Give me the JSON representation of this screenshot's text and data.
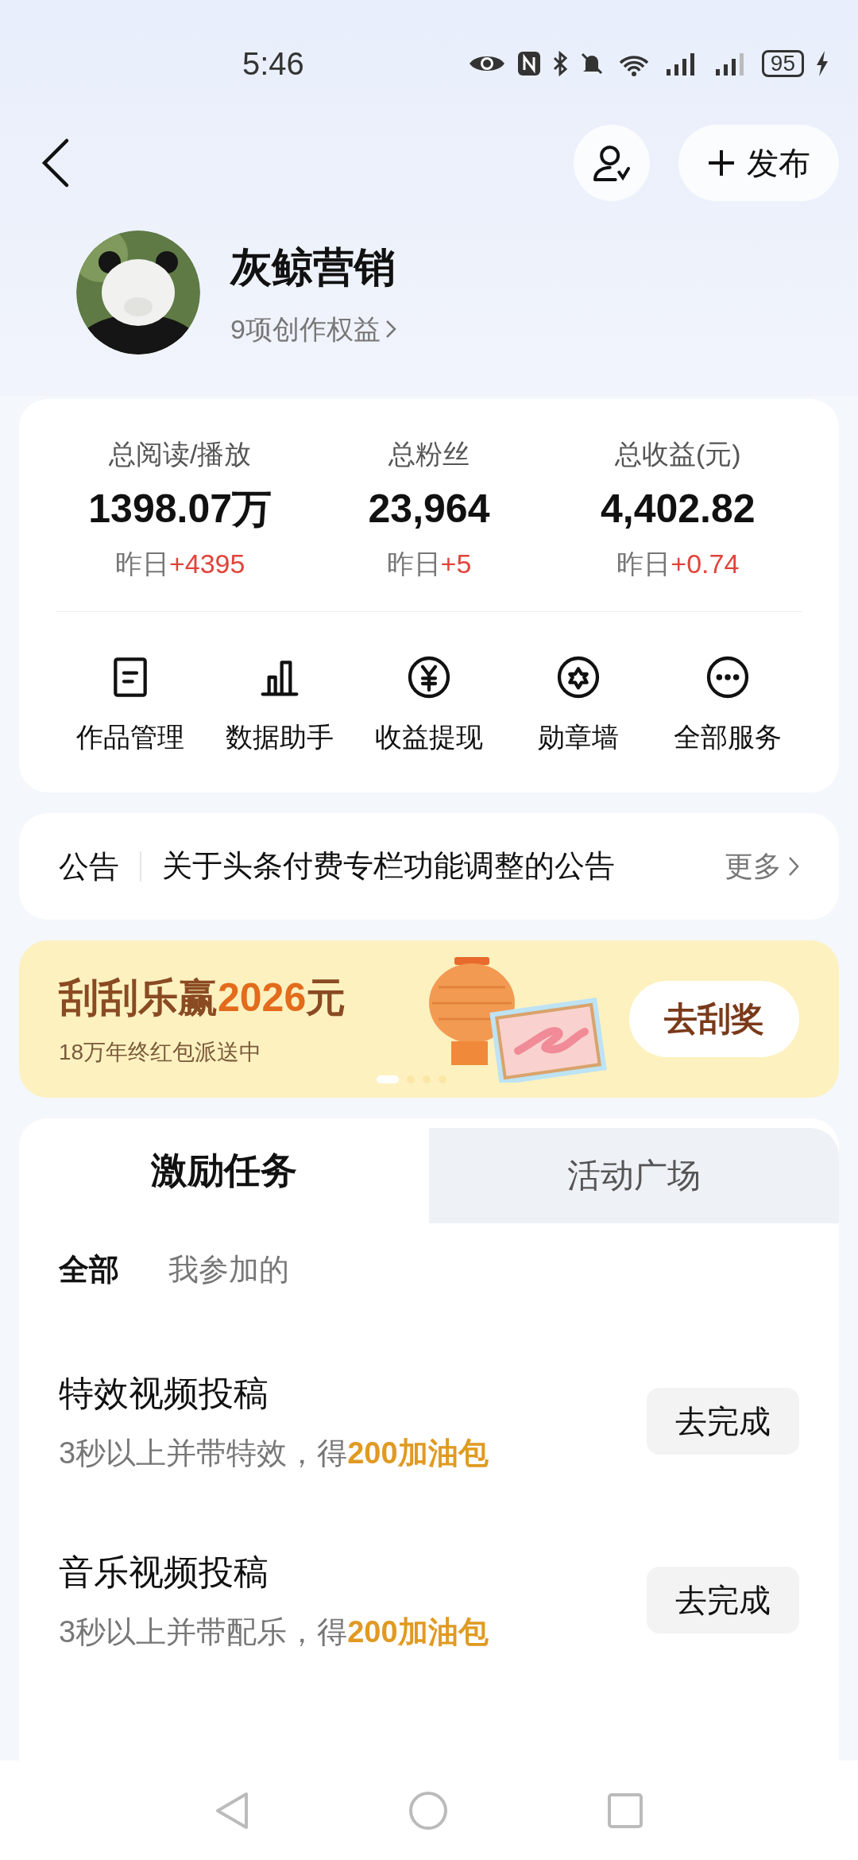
{
  "status_bar": {
    "time": "5:46",
    "battery": "95"
  },
  "header": {
    "publish_button": "发布"
  },
  "profile": {
    "name": "灰鲸营销",
    "benefits_link": "9项创作权益"
  },
  "stats": [
    {
      "label": "总阅读/播放",
      "value": "1398.07万",
      "delta_label": "昨日",
      "delta": "+4395"
    },
    {
      "label": "总粉丝",
      "value": "23,964",
      "delta_label": "昨日",
      "delta": "+5"
    },
    {
      "label": "总收益(元)",
      "value": "4,402.82",
      "delta_label": "昨日",
      "delta": "+0.74"
    }
  ],
  "services": [
    {
      "kind": "document",
      "label": "作品管理"
    },
    {
      "kind": "chart",
      "label": "数据助手"
    },
    {
      "kind": "yuan",
      "label": "收益提现"
    },
    {
      "kind": "badge",
      "label": "勋章墙"
    },
    {
      "kind": "more",
      "label": "全部服务"
    }
  ],
  "announcement": {
    "tag": "公告",
    "text": "关于头条付费专栏功能调整的公告",
    "more": "更多"
  },
  "banner": {
    "title": "刮刮乐赢",
    "amount": "2026",
    "unit": "元",
    "subtitle": "18万年终红包派送中",
    "button": "去刮奖",
    "dots": [
      {
        "selected": true
      },
      {
        "selected": false
      },
      {
        "selected": false
      },
      {
        "selected": false
      }
    ]
  },
  "tabs": [
    {
      "label": "激励任务",
      "selected": true
    },
    {
      "label": "活动广场",
      "selected": false
    }
  ],
  "filters": [
    {
      "label": "全部",
      "selected": true
    },
    {
      "label": "我参加的",
      "selected": false
    }
  ],
  "tasks": [
    {
      "title": "特效视频投稿",
      "desc": "3秒以上并带特效，得",
      "reward": "200加油包",
      "button": "去完成"
    },
    {
      "title": "音乐视频投稿",
      "desc": "3秒以上并带配乐，得",
      "reward": "200加油包",
      "button": "去完成"
    }
  ]
}
